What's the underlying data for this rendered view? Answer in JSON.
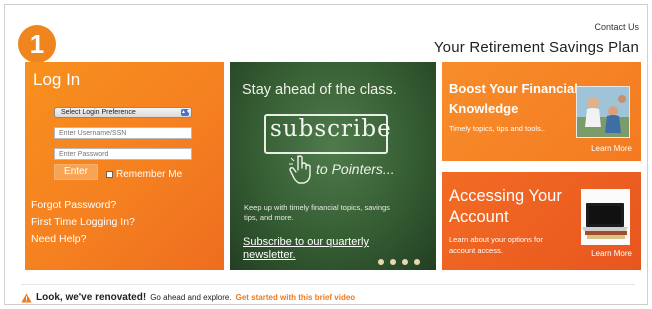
{
  "header": {
    "logo_number": "1",
    "contact_link": "Contact Us",
    "plan_title": "Your Retirement Savings Plan"
  },
  "login": {
    "title": "Log In",
    "select_value": "Select Login Preference",
    "username_placeholder": "Enter Username/SSN",
    "password_placeholder": "Enter Password",
    "enter_label": "Enter",
    "remember_label": "Remember Me",
    "links": [
      "Forgot Password?",
      "First Time Logging In?",
      "Need Help?"
    ]
  },
  "promo": {
    "headline": "Stay ahead of the class.",
    "chalk_word": "subscribe",
    "pointers": "to Pointers...",
    "description": "Keep up with timely financial topics, savings tips, and more.",
    "link_text": "Subscribe to our quarterly newsletter.",
    "slide_count": 4
  },
  "boost": {
    "title": "Boost Your Financial Knowledge",
    "subtitle": "Timely topics, tips and tools..",
    "learn_more": "Learn More"
  },
  "access": {
    "title": "Accessing Your Account",
    "subtitle": "Learn about your options for account access.",
    "learn_more": "Learn More"
  },
  "notice": {
    "bold": "Look, we've renovated!",
    "text": "Go ahead and explore.",
    "link": "Get started with this brief video"
  },
  "colors": {
    "accent_orange": "#f58020",
    "chalkboard_green": "#355d33",
    "accessing_orange": "#e8561f"
  },
  "icons": [
    "warning-icon",
    "hand-pointer-icon",
    "select-arrows-icon"
  ]
}
